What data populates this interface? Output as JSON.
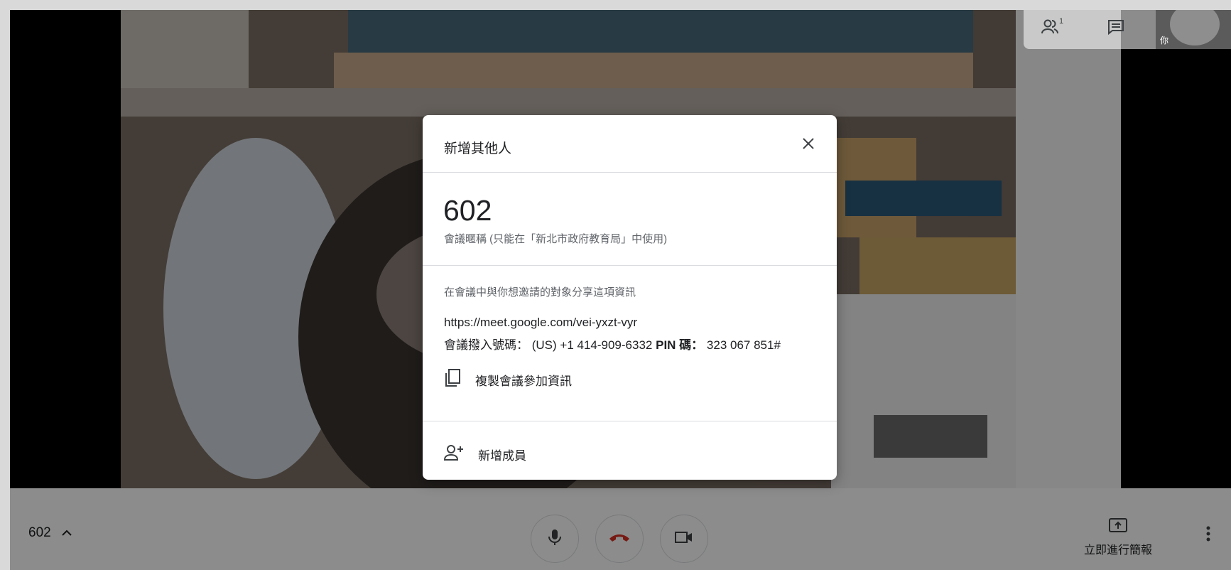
{
  "self_label": "你",
  "participants_count": "1",
  "bottombar": {
    "meeting_code": "602",
    "present_label": "立即進行簡報"
  },
  "dialog": {
    "title": "新增其他人",
    "meeting_code": "602",
    "nickname_note": "會議暱稱 (只能在「新北市政府教育局」中使用)",
    "share_prompt": "在會議中與你想邀請的對象分享這項資訊",
    "meeting_link": "https://meet.google.com/vei-yxzt-vyr",
    "dial_label": "會議撥入號碼：",
    "dial_number": "(US) +1 414-909-6332",
    "pin_label": "PIN 碼：",
    "pin_value": "323 067 851#",
    "copy_label": "複製會議參加資訊",
    "add_label": "新增成員"
  },
  "colors": {
    "end_call": "#d93025",
    "text": "#202124",
    "secondary_text": "#5f6368"
  },
  "icons": [
    "people-icon",
    "chat-icon",
    "close-icon",
    "copy-icon",
    "add-person-icon",
    "mic-icon",
    "end-call-icon",
    "camera-icon",
    "present-icon",
    "more-vert-icon",
    "chevron-up-icon"
  ]
}
